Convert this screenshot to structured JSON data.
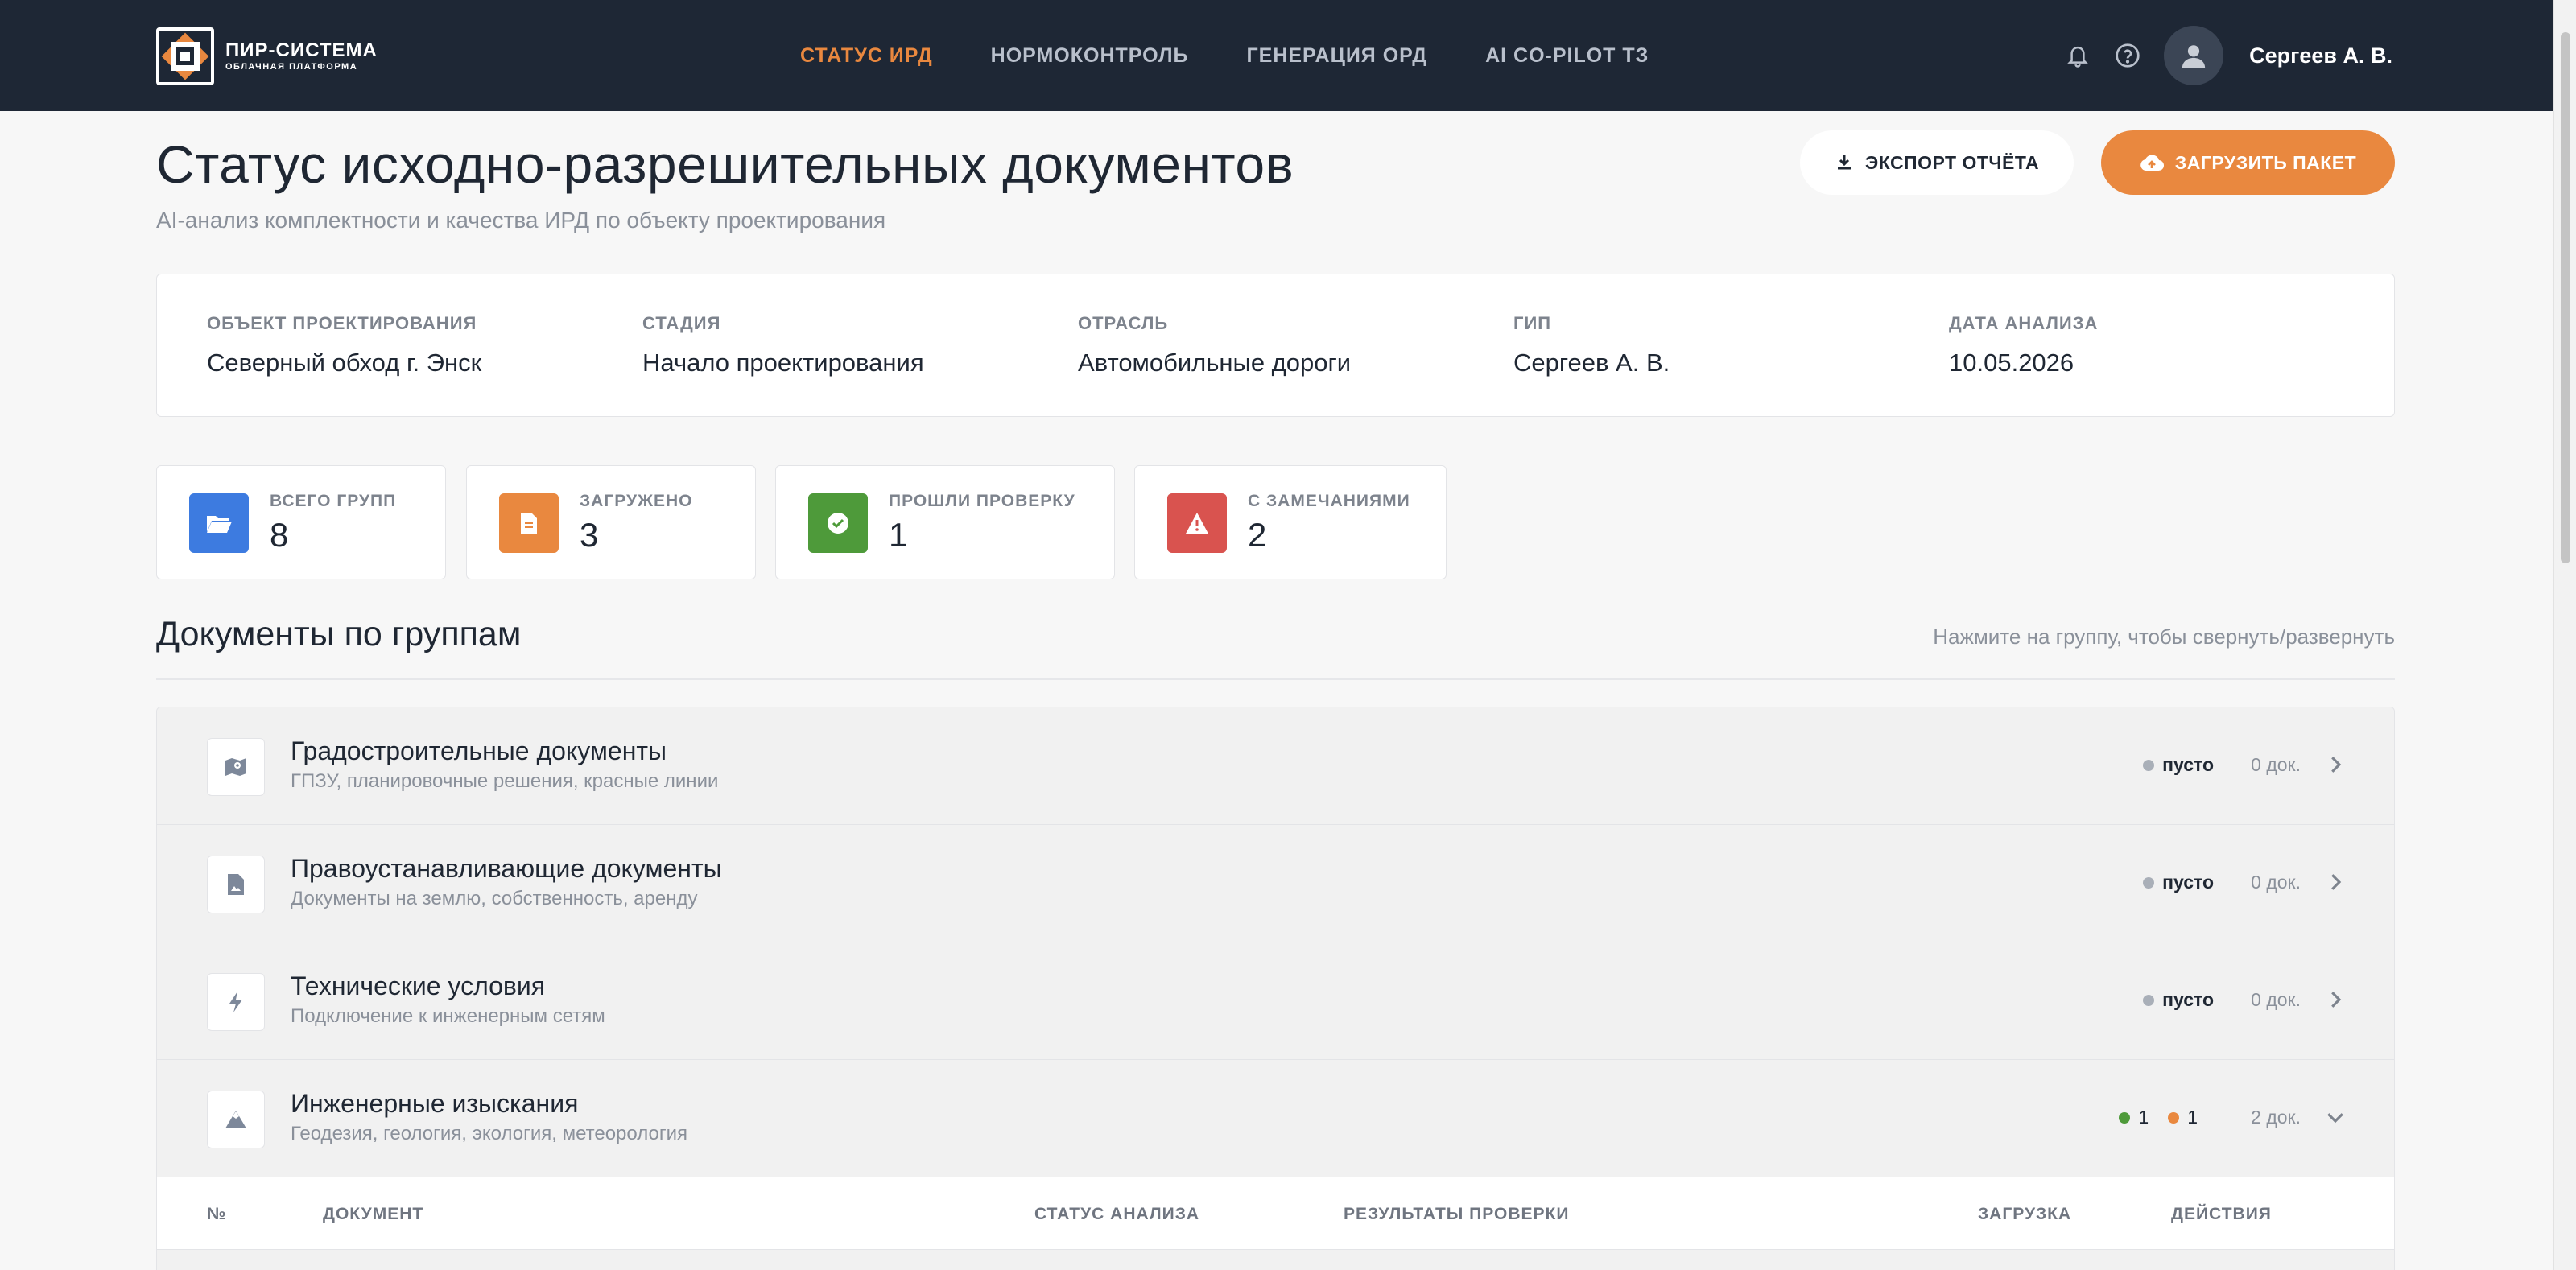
{
  "header": {
    "logo_line1": "ПИР-СИСТЕМА",
    "logo_line2": "ОБЛАЧНАЯ ПЛАТФОРМА",
    "nav": [
      {
        "label": "СТАТУС ИРД",
        "active": true
      },
      {
        "label": "НОРМОКОНТРОЛЬ",
        "active": false
      },
      {
        "label": "ГЕНЕРАЦИЯ ОРД",
        "active": false
      },
      {
        "label": "AI CO-PILOT ТЗ",
        "active": false
      }
    ],
    "user_name": "Сергеев А. В."
  },
  "page": {
    "title": "Статус исходно-разрешительных документов",
    "subtitle": "AI-анализ комплектности и качества ИРД по объекту проектирования",
    "export_label": "ЭКСПОРТ ОТЧЁТА",
    "upload_label": "ЗАГРУЗИТЬ ПАКЕТ"
  },
  "info": [
    {
      "label": "ОБЪЕКТ ПРОЕКТИРОВАНИЯ",
      "value": "Северный обход г. Энск"
    },
    {
      "label": "СТАДИЯ",
      "value": "Начало проектирования"
    },
    {
      "label": "ОТРАСЛЬ",
      "value": "Автомобильные дороги"
    },
    {
      "label": "ГИП",
      "value": "Сергеев А. В."
    },
    {
      "label": "ДАТА АНАЛИЗА",
      "value": "10.05.2026"
    }
  ],
  "stats": [
    {
      "label": "ВСЕГО ГРУПП",
      "value": "8",
      "icon": "folder-icon",
      "color": "#3d7be0"
    },
    {
      "label": "ЗАГРУЖЕНО",
      "value": "3",
      "icon": "document-icon",
      "color": "#e9883f"
    },
    {
      "label": "ПРОШЛИ ПРОВЕРКУ",
      "value": "1",
      "icon": "check-icon",
      "color": "#4e9a3a"
    },
    {
      "label": "С ЗАМЕЧАНИЯМИ",
      "value": "2",
      "icon": "warning-icon",
      "color": "#d9534f"
    }
  ],
  "section": {
    "title": "Документы по группам",
    "hint": "Нажмите на группу, чтобы свернуть/развернуть"
  },
  "groups": [
    {
      "title": "Градостроительные документы",
      "subtitle": "ГПЗУ, планировочные решения, красные линии",
      "status": "пусто",
      "count": "0 док.",
      "icon": "map-icon",
      "expanded": false
    },
    {
      "title": "Правоустанавливающие документы",
      "subtitle": "Документы на землю, собственность, аренду",
      "status": "пусто",
      "count": "0 док.",
      "icon": "document-image-icon",
      "expanded": false
    },
    {
      "title": "Технические условия",
      "subtitle": "Подключение к инженерным сетям",
      "status": "пусто",
      "count": "0 док.",
      "icon": "lightning-icon",
      "expanded": false
    },
    {
      "title": "Инженерные изыскания",
      "subtitle": "Геодезия, геология, экология, метеорология",
      "ok_count": "1",
      "warn_count": "1",
      "count": "2 док.",
      "icon": "mountain-icon",
      "expanded": true
    }
  ],
  "table_headers": [
    "№",
    "ДОКУМЕНТ",
    "СТАТУС АНАЛИЗА",
    "РЕЗУЛЬТАТЫ ПРОВЕРКИ",
    "ЗАГРУЗКА",
    "ДЕЙСТВИЯ"
  ],
  "colors": {
    "accent": "#e9883f",
    "header_bg": "#1e2735",
    "ok": "#4e9a3a",
    "warn": "#e9883f",
    "empty": "#a9afb8"
  }
}
